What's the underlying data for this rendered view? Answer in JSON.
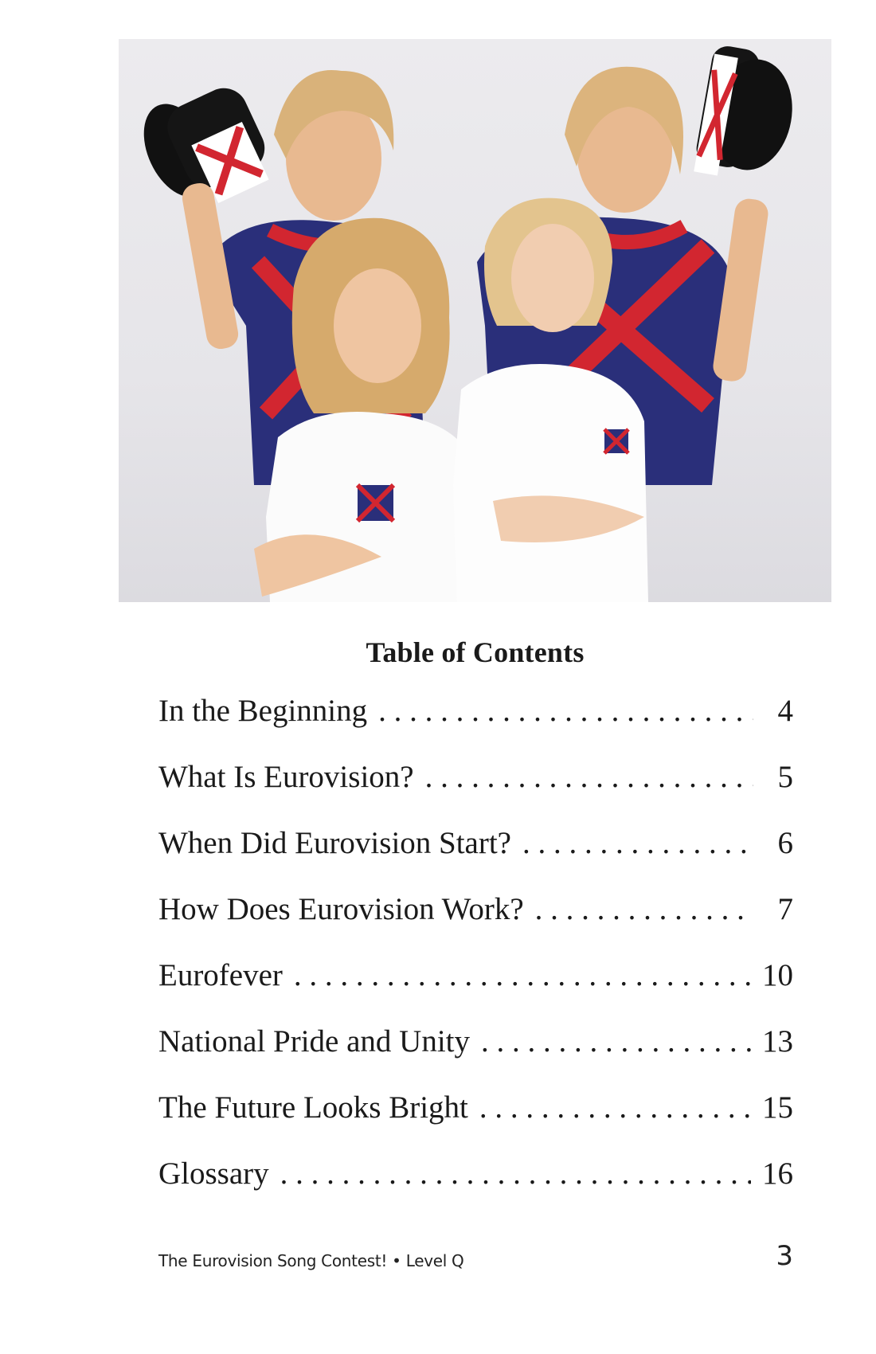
{
  "toc": {
    "title": "Table of Contents",
    "entries": [
      {
        "label": "In the Beginning",
        "page": "4"
      },
      {
        "label": "What Is Eurovision?",
        "page": "5"
      },
      {
        "label": "When Did Eurovision Start?",
        "page": "6"
      },
      {
        "label": "How Does Eurovision Work?",
        "page": "7"
      },
      {
        "label": "Eurofever",
        "page": "10"
      },
      {
        "label": "National Pride and Unity",
        "page": "13"
      },
      {
        "label": "The Future Looks Bright",
        "page": "15"
      },
      {
        "label": "Glossary",
        "page": "16"
      }
    ]
  },
  "footer": {
    "book": "The Eurovision Song Contest! • Level Q",
    "page_number": "3"
  },
  "colors": {
    "union_red": "#d22630",
    "union_blue": "#2a2f7a",
    "text": "#1a1a1a"
  }
}
